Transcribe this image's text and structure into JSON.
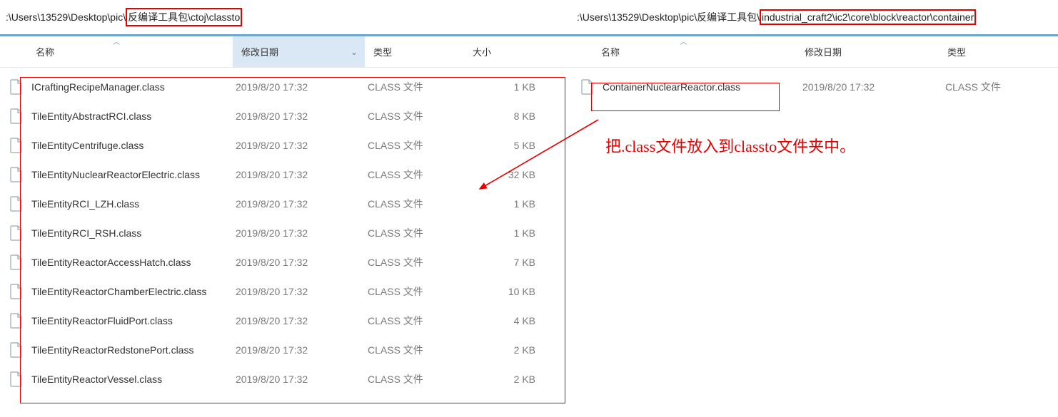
{
  "left": {
    "path_prefix": ":\\Users\\13529\\Desktop\\pic\\",
    "path_highlight": "反编译工具包\\ctoj\\classto",
    "columns": {
      "name": "名称",
      "date": "修改日期",
      "type": "类型",
      "size": "大小"
    },
    "files": [
      {
        "name": "ICraftingRecipeManager.class",
        "date": "2019/8/20 17:32",
        "type": "CLASS 文件",
        "size": "1 KB"
      },
      {
        "name": "TileEntityAbstractRCI.class",
        "date": "2019/8/20 17:32",
        "type": "CLASS 文件",
        "size": "8 KB"
      },
      {
        "name": "TileEntityCentrifuge.class",
        "date": "2019/8/20 17:32",
        "type": "CLASS 文件",
        "size": "5 KB"
      },
      {
        "name": "TileEntityNuclearReactorElectric.class",
        "date": "2019/8/20 17:32",
        "type": "CLASS 文件",
        "size": "32 KB"
      },
      {
        "name": "TileEntityRCI_LZH.class",
        "date": "2019/8/20 17:32",
        "type": "CLASS 文件",
        "size": "1 KB"
      },
      {
        "name": "TileEntityRCI_RSH.class",
        "date": "2019/8/20 17:32",
        "type": "CLASS 文件",
        "size": "1 KB"
      },
      {
        "name": "TileEntityReactorAccessHatch.class",
        "date": "2019/8/20 17:32",
        "type": "CLASS 文件",
        "size": "7 KB"
      },
      {
        "name": "TileEntityReactorChamberElectric.class",
        "date": "2019/8/20 17:32",
        "type": "CLASS 文件",
        "size": "10 KB"
      },
      {
        "name": "TileEntityReactorFluidPort.class",
        "date": "2019/8/20 17:32",
        "type": "CLASS 文件",
        "size": "4 KB"
      },
      {
        "name": "TileEntityReactorRedstonePort.class",
        "date": "2019/8/20 17:32",
        "type": "CLASS 文件",
        "size": "2 KB"
      },
      {
        "name": "TileEntityReactorVessel.class",
        "date": "2019/8/20 17:32",
        "type": "CLASS 文件",
        "size": "2 KB"
      }
    ]
  },
  "right": {
    "path_prefix": ":\\Users\\13529\\Desktop\\pic\\反编译工具包\\",
    "path_highlight": "industrial_craft2\\ic2\\core\\block\\reactor\\container",
    "columns": {
      "name": "名称",
      "date": "修改日期",
      "type": "类型"
    },
    "files": [
      {
        "name": "ContainerNuclearReactor.class",
        "date": "2019/8/20 17:32",
        "type": "CLASS 文件"
      }
    ]
  },
  "annotation": "把.class文件放入到classto文件夹中。"
}
